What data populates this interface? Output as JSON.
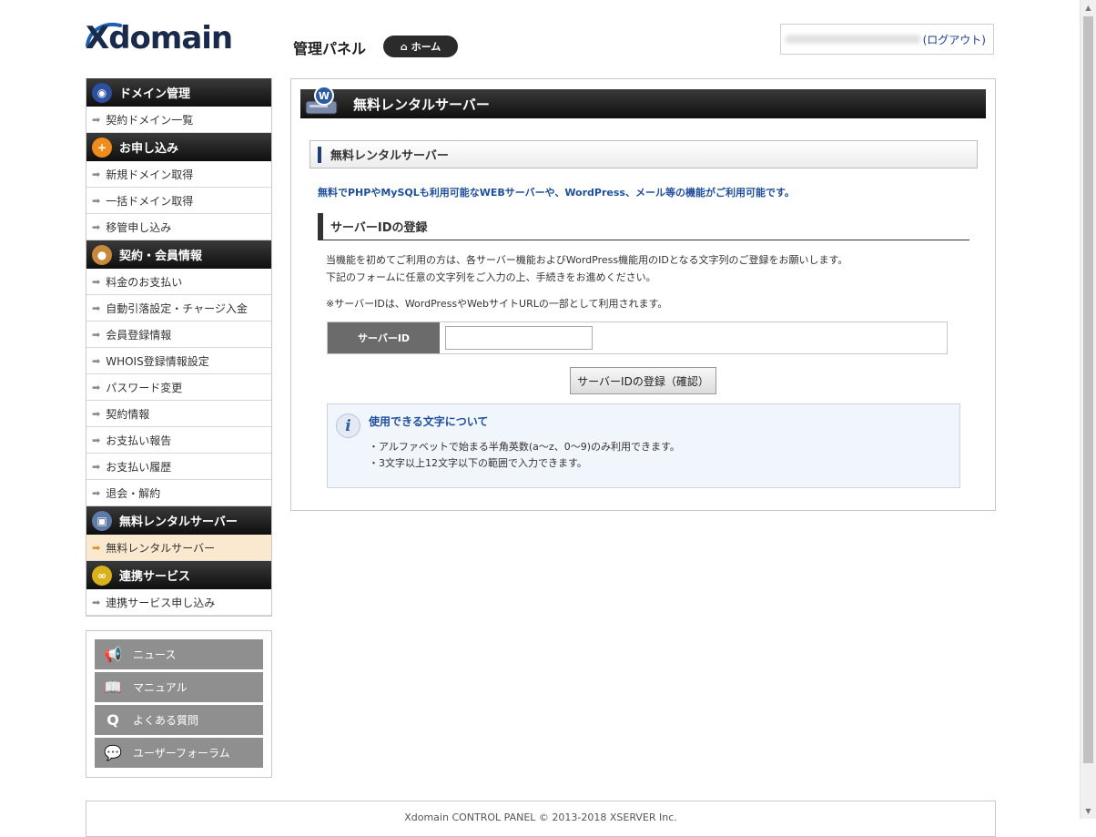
{
  "header": {
    "logo_text": "Xdomain",
    "panel_title": "管理パネル",
    "home_label": "ホーム",
    "logout_label": "(ログアウト)"
  },
  "sidebar": {
    "sections": [
      {
        "title": "ドメイン管理",
        "icon": "globe-icon",
        "color": "#2d4fa0",
        "items": [
          {
            "label": "契約ドメイン一覧"
          }
        ]
      },
      {
        "title": "お申し込み",
        "icon": "plus-icon",
        "color": "#f08c1c",
        "items": [
          {
            "label": "新規ドメイン取得"
          },
          {
            "label": "一括ドメイン取得"
          },
          {
            "label": "移管申し込み"
          }
        ]
      },
      {
        "title": "契約・会員情報",
        "icon": "user-icon",
        "color": "#c88a3a",
        "items": [
          {
            "label": "料金のお支払い"
          },
          {
            "label": "自動引落設定・チャージ入金"
          },
          {
            "label": "会員登録情報"
          },
          {
            "label": "WHOIS登録情報設定"
          },
          {
            "label": "パスワード変更"
          },
          {
            "label": "契約情報"
          },
          {
            "label": "お支払い報告"
          },
          {
            "label": "お支払い履歴"
          },
          {
            "label": "退会・解約"
          }
        ]
      },
      {
        "title": "無料レンタルサーバー",
        "icon": "server-icon",
        "color": "#5d7aa8",
        "items": [
          {
            "label": "無料レンタルサーバー",
            "active": true
          }
        ]
      },
      {
        "title": "連携サービス",
        "icon": "link-icon",
        "color": "#d9b21a",
        "items": [
          {
            "label": "連携サービス申し込み"
          }
        ]
      }
    ],
    "links": [
      {
        "label": "ニュース",
        "icon": "megaphone-icon",
        "glyph": "📢"
      },
      {
        "label": "マニュアル",
        "icon": "book-icon",
        "glyph": "📖"
      },
      {
        "label": "よくある質問",
        "icon": "q-icon",
        "glyph": "Q"
      },
      {
        "label": "ユーザーフォーラム",
        "icon": "chat-icon",
        "glyph": "💬"
      }
    ]
  },
  "main": {
    "page_title": "無料レンタルサーバー",
    "sub_title": "無料レンタルサーバー",
    "lead": "無料でPHPやMySQLも利用可能なWEBサーバーや、WordPress、メール等の機能がご利用可能です。",
    "section_title": "サーバーIDの登録",
    "desc_line1": "当機能を初めてご利用の方は、各サーバー機能およびWordPress機能用のIDとなる文字列のご登録をお願いします。",
    "desc_line2": "下記のフォームに任意の文字列をご入力の上、手続きをお進めください。",
    "note": "※サーバーIDは、WordPressやWebサイトURLの一部として利用されます。",
    "form_label": "サーバーID",
    "form_value": "",
    "submit_label": "サーバーIDの登録（確認）",
    "info_title": "使用できる文字について",
    "info_line1": "・アルファベットで始まる半角英数(a～z、0～9)のみ利用できます。",
    "info_line2": "・3文字以上12文字以下の範囲で入力できます。"
  },
  "footer": {
    "text": "Xdomain CONTROL PANEL © 2013-2018 XSERVER Inc."
  }
}
